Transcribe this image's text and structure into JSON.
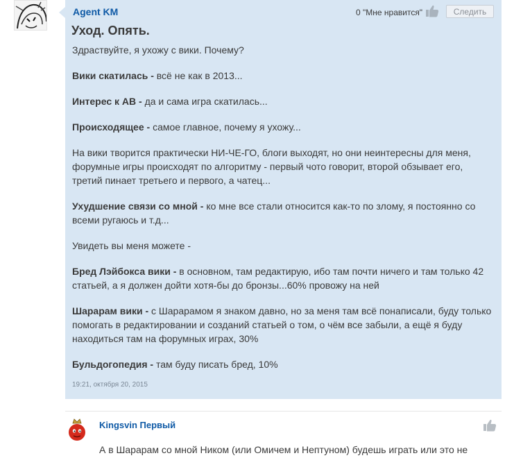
{
  "post": {
    "author": "Agent KM",
    "likes_label": "0 \"Мне нравится\"",
    "follow_label": "Следить",
    "title": "Уход. Опять.",
    "intro": "Здраствуйте, я ухожу с вики. Почему?",
    "paragraphs": [
      {
        "bold": "Вики скатилась - ",
        "text": "всё не как в 2013..."
      },
      {
        "bold": "Интерес к АВ - ",
        "text": "да и сама игра скатилась..."
      },
      {
        "bold": "Происходящее - ",
        "text": "самое главное, почему я ухожу..."
      },
      {
        "bold": "",
        "text": "На вики творится практически НИ-ЧЕ-ГО, блоги выходят, но они неинтересны для меня, форумные игры происходят по алгоритму - первый чото говорит, второй обзывает его, третий пинает третьего и первого, а чатец..."
      },
      {
        "bold": "Ухудшение связи со мной - ",
        "text": "ко мне все стали относится как-то по злому, я постоянно со всеми ругаюсь и т.д..."
      },
      {
        "bold": "",
        "text": "Увидеть вы меня можете -"
      },
      {
        "bold": "Бред Лэйбокса вики - ",
        "text": "в основном, там редактирую, ибо там почти ничего и там только 42 статьей, а я должен дойти хотя-бы до бронзы...60% провожу на ней"
      },
      {
        "bold": "Шарарам вики - ",
        "text": "с Шарарамом я знаком давно, но за меня там всё понаписали, буду только помогать в редактировании и созданий статьей о том, о чём все забыли, а ещё я буду находиться там на форумных играх, 30%"
      },
      {
        "bold": "Бульдогопедия - ",
        "text": "там буду писать бред, 10%"
      }
    ],
    "timestamp": "19:21, октября 20, 2015"
  },
  "comment": {
    "author": "Kingsvin Первый",
    "text": "А в Шарарам со мной Ником (или Омичем и Нептуном) будешь играть или это не"
  },
  "icons": {
    "like": "thumbs-up-icon",
    "avatar1": "drawn-character-avatar",
    "avatar2": "red-creature-with-crown-avatar"
  },
  "colors": {
    "post_bg": "#d8e6f3",
    "link": "#0f5aa6",
    "text": "#3a3a3a"
  }
}
